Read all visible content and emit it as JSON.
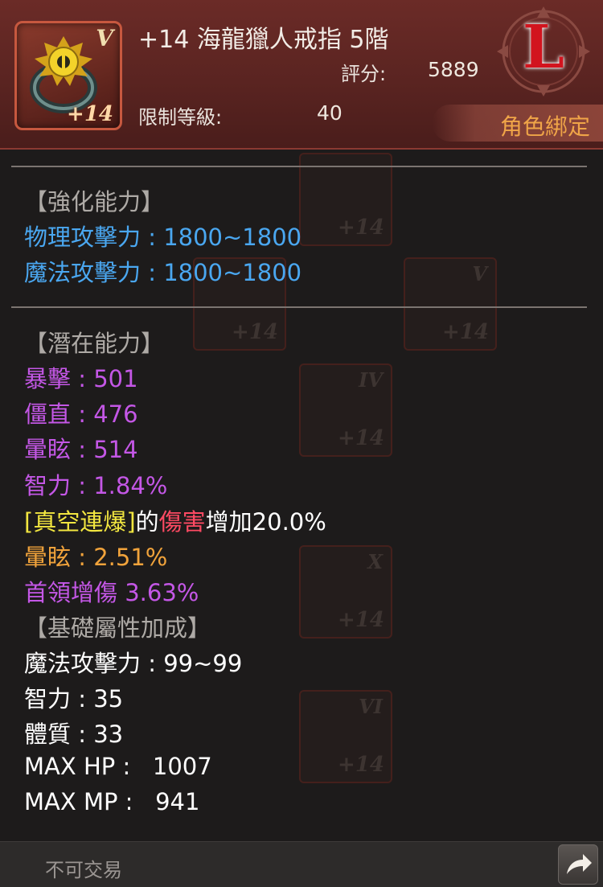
{
  "item": {
    "icon_name": "sea-dragon-ring-icon",
    "icon_tier": "V",
    "icon_level": "+14",
    "title": "+14 海龍獵人戒指 5階",
    "score_label": "評分:",
    "score_value": "5889",
    "level_label": "限制等級:",
    "level_value": "40",
    "rank": "L",
    "bind_status": "角色綁定"
  },
  "sections": {
    "enhance": {
      "heading": "【強化能力】",
      "lines": [
        "物理攻擊力 : 1800~1800",
        "魔法攻擊力 : 1800~1800"
      ]
    },
    "potential": {
      "heading": "【潛在能力】",
      "lines": [
        "暴擊 : 501",
        "僵直 : 476",
        "暈眩 : 514",
        "智力 : 1.84%"
      ],
      "skill_bracket": "[真空連爆]",
      "skill_de": "的",
      "skill_damage": "傷害",
      "skill_increase": "增加20.0%",
      "stun_line": "暈眩 : 2.51%",
      "boss_line": "首領增傷 3.63%"
    },
    "base": {
      "heading": "【基礎屬性加成】",
      "lines": [
        "魔法攻擊力 : 99~99",
        "智力 : 35",
        "體質 : 33",
        "MAX HP :   1007",
        "MAX MP :   941"
      ]
    }
  },
  "footer": {
    "trade_status": "不可交易",
    "share_icon": "share-arrow-icon"
  },
  "colors": {
    "enhance": "#4aa7f0",
    "potential": "#c457e6",
    "orange": "#f1a33b",
    "skill": "#f2e640",
    "damage": "#ff4a63",
    "bind": "#f0a548",
    "rank": "#d2141e"
  }
}
